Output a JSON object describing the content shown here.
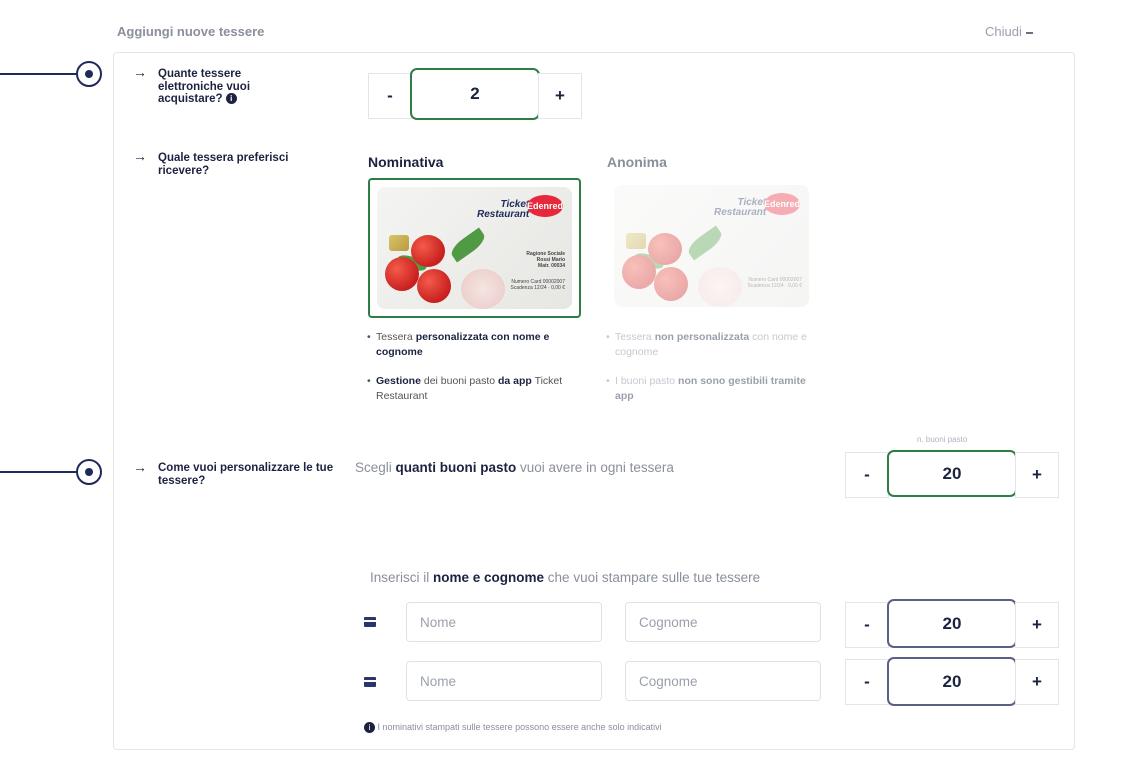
{
  "header": {
    "title": "Aggiungi nuove tessere",
    "close_label": "Chiudi"
  },
  "questions": {
    "quantity": "Quante tessere elettroniche vuoi acquistare?",
    "preference": "Quale tessera preferisci ricevere?",
    "personalize": "Come vuoi personalizzare le tue tessere?"
  },
  "card_stepper": {
    "minus": "-",
    "value": "2",
    "plus": "+"
  },
  "options": {
    "nominativa": {
      "title": "Nominativa",
      "bullet1_pre": "Tessera ",
      "bullet1_bold": "personalizzata con nome e cognome",
      "bullet2_bold": "Gestione",
      "bullet2_mid": " dei buoni pasto ",
      "bullet2_bold2": "da app",
      "bullet2_post": " Ticket Restaurant"
    },
    "anonima": {
      "title": "Anonima",
      "bullet1_pre": "Tessera ",
      "bullet1_bold": "non personalizzata",
      "bullet1_post": " con nome e cognome",
      "bullet2_pre": "I buoni pasto ",
      "bullet2_bold": "non sono gestibili tramite app"
    },
    "card_brand_line1": "Ticket",
    "card_brand_line2": "Restaurant",
    "card_logo": "Edenred",
    "card_details_line1": "Ragione Sociale",
    "card_details_line2": "Rossi Mario",
    "card_details_line3": "Matr. 00034",
    "card_details_line4": "Numero Card 00002007",
    "card_details_line5": "Scadenza 12/24 · 0,00 €"
  },
  "vouchers": {
    "prompt_pre": "Scegli ",
    "prompt_bold": "quanti buoni pasto",
    "prompt_post": " vuoi avere in ogni tessera",
    "label": "n. buoni pasto",
    "minus": "-",
    "value": "20",
    "plus": "+"
  },
  "names": {
    "prompt_pre": "Inserisci il ",
    "prompt_bold": "nome e cognome",
    "prompt_post": " che vuoi stampare sulle tue tessere",
    "rows": [
      {
        "first_placeholder": "Nome",
        "last_placeholder": "Cognome",
        "minus": "-",
        "value": "20",
        "plus": "+"
      },
      {
        "first_placeholder": "Nome",
        "last_placeholder": "Cognome",
        "minus": "-",
        "value": "20",
        "plus": "+"
      }
    ]
  },
  "footnote": "I nominativi stampati sulle tessere possono essere anche solo indicativi",
  "colors": {
    "selected_border": "#2e7d47",
    "navy": "#1c2340",
    "brand_red": "#e6283a"
  },
  "icons": [
    "arrow-right-icon",
    "info-icon",
    "card-icon",
    "timeline-marker-icon"
  ]
}
